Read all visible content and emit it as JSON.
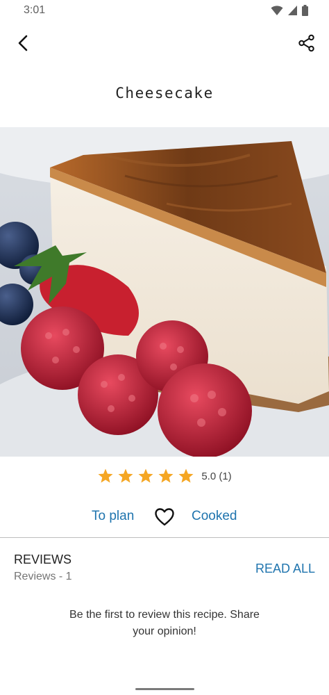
{
  "status_bar": {
    "time": "3:01",
    "icons": [
      "wifi-icon",
      "cellular-signal-icon",
      "battery-icon"
    ]
  },
  "app_bar": {
    "back_icon": "back-arrow-icon",
    "share_icon": "share-icon"
  },
  "recipe": {
    "title": "Cheesecake",
    "image_subject": "cheesecake slice with raspberries, strawberry and blueberries"
  },
  "rating": {
    "stars": 5,
    "max_stars": 5,
    "text": "5.0 (1)",
    "star_color": "#f5a623"
  },
  "actions": {
    "to_plan_label": "To plan",
    "favorite_icon": "heart-outline-icon",
    "cooked_label": "Cooked",
    "link_color": "#1f74ae"
  },
  "reviews": {
    "heading": "REVIEWS",
    "count_label": "Reviews - 1",
    "read_all_label": "READ ALL",
    "empty_message": "Be the first to review this recipe. Share your opinion!"
  }
}
